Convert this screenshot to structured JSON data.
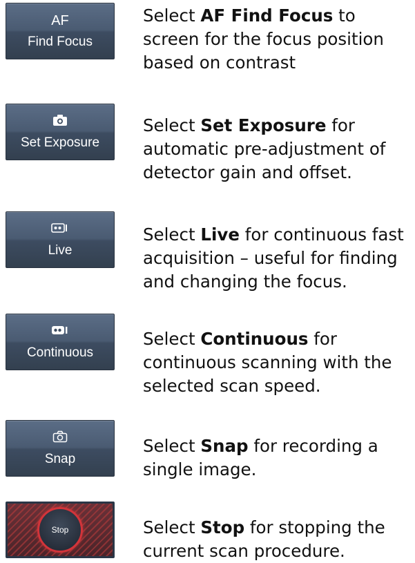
{
  "items": [
    {
      "button": {
        "top_text": "AF",
        "label": "Find Focus"
      },
      "desc": {
        "prefix": "Select ",
        "bold": "AF Find Focus",
        "suffix": " to screen for the focus position based on contrast"
      }
    },
    {
      "button": {
        "icon": "camera-icon",
        "label": "Set Exposure"
      },
      "desc": {
        "prefix": "Select ",
        "bold": "Set Exposure",
        "suffix": " for automatic pre-adjustment of detector gain and offset."
      }
    },
    {
      "button": {
        "icon": "live-video-icon",
        "label": "Live"
      },
      "desc": {
        "prefix": "Select ",
        "bold": "Live",
        "suffix": " for continuous fast acquisition – useful for finding and changing the focus."
      }
    },
    {
      "button": {
        "icon": "video-camera-icon",
        "label": "Continuous"
      },
      "desc": {
        "prefix": "Select ",
        "bold": "Continuous",
        "suffix": " for continuous scanning with the selected scan speed."
      }
    },
    {
      "button": {
        "icon": "camera-outline-icon",
        "label": "Snap"
      },
      "desc": {
        "prefix": "Select ",
        "bold": "Snap",
        "suffix": " for recording a single image."
      }
    },
    {
      "button": {
        "icon": "stop-icon",
        "label": "Stop"
      },
      "desc": {
        "prefix": "Select ",
        "bold": "Stop",
        "suffix": " for stopping the current scan procedure."
      }
    }
  ],
  "colors": {
    "button_bg": "#4a5b72",
    "stop_ring": "#d2343a",
    "text": "#111111"
  }
}
